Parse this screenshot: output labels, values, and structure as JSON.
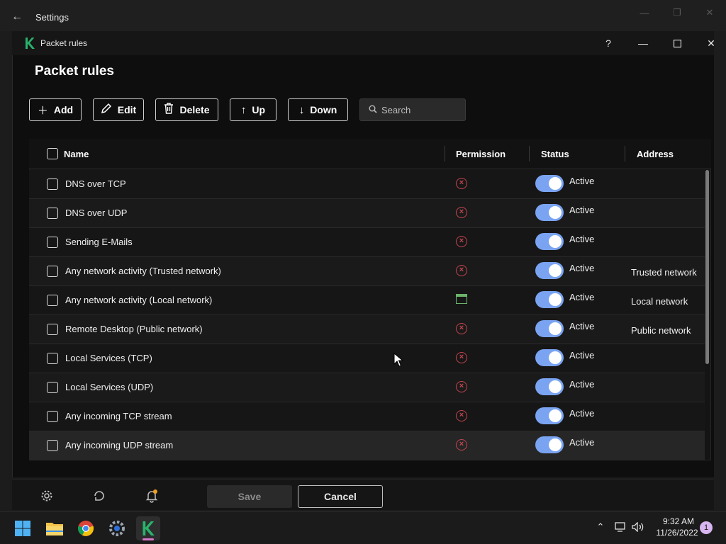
{
  "outer_window": {
    "title": "Settings"
  },
  "inner_window": {
    "title": "Packet rules",
    "help_label": "?"
  },
  "page": {
    "heading": "Packet rules"
  },
  "toolbar": {
    "add_label": "Add",
    "edit_label": "Edit",
    "delete_label": "Delete",
    "up_label": "Up",
    "down_label": "Down",
    "search_placeholder": "Search"
  },
  "table": {
    "columns": {
      "name": "Name",
      "permission": "Permission",
      "status": "Status",
      "address": "Address"
    },
    "rows": [
      {
        "name": "DNS over TCP",
        "permission": "block",
        "status": "Active",
        "address": ""
      },
      {
        "name": "DNS over UDP",
        "permission": "block",
        "status": "Active",
        "address": ""
      },
      {
        "name": "Sending E-Mails",
        "permission": "block",
        "status": "Active",
        "address": ""
      },
      {
        "name": "Any network activity (Trusted network)",
        "permission": "block",
        "status": "Active",
        "address": "Trusted network"
      },
      {
        "name": "Any network activity (Local network)",
        "permission": "app-rules",
        "status": "Active",
        "address": "Local network"
      },
      {
        "name": "Remote Desktop (Public network)",
        "permission": "block",
        "status": "Active",
        "address": "Public network"
      },
      {
        "name": "Local Services (TCP)",
        "permission": "block",
        "status": "Active",
        "address": ""
      },
      {
        "name": "Local Services (UDP)",
        "permission": "block",
        "status": "Active",
        "address": ""
      },
      {
        "name": "Any incoming TCP stream",
        "permission": "block",
        "status": "Active",
        "address": ""
      },
      {
        "name": "Any incoming UDP stream",
        "permission": "block",
        "status": "Active",
        "address": ""
      }
    ]
  },
  "footer": {
    "save_label": "Save",
    "cancel_label": "Cancel"
  },
  "taskbar": {
    "time": "9:32 AM",
    "date": "11/26/2022",
    "notification_count": "1"
  },
  "colors": {
    "accent_toggle": "#7aa4f2",
    "deny_red": "#c2454f",
    "allow_green": "#6bb36b",
    "brand_green": "#29b36b"
  }
}
